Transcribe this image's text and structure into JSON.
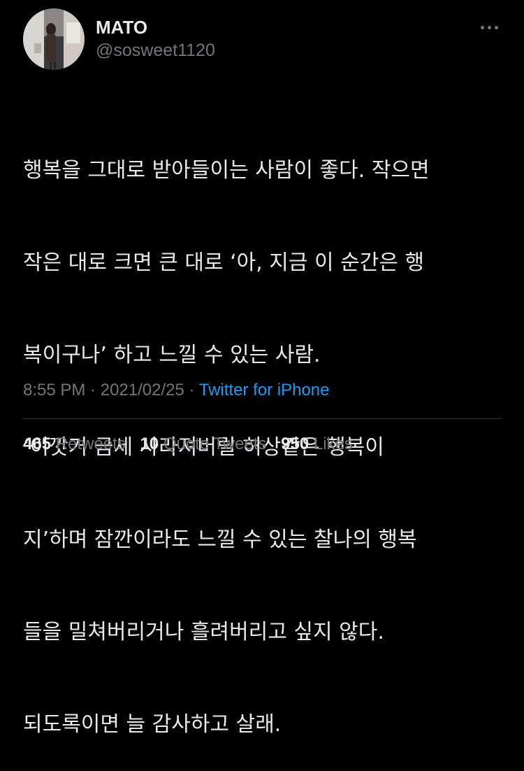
{
  "user": {
    "display_name": "MATO",
    "handle": "@sosweet1120",
    "avatar_icon": "profile-photo"
  },
  "more_icon": "ellipsis-icon",
  "tweet": {
    "lines": [
      "행복을 그대로 받아들이는 사람이 좋다. 작으면",
      "작은 대로 크면 큰 대로 ‘아, 지금 이 순간은 행",
      "복이구나’ 하고 느낄 수 있는 사람.",
      "‘이깟거 금세 사라져버릴 허상같은 행복이",
      "지’하며 잠깐이라도 느낄 수 있는 찰나의 행복",
      "들을 밀쳐버리거나 흘려버리고 싶지 않다.",
      "되도록이면 늘 감사하고 살래."
    ]
  },
  "meta": {
    "time": "8:55 PM",
    "separator": " · ",
    "date": "2021/02/25",
    "separator2": " · ",
    "source": "Twitter for iPhone"
  },
  "stats": {
    "retweets_count": "465",
    "retweets_label": "Retweets",
    "quotes_count": "10",
    "quotes_label": "Quote Tweets",
    "likes_count": "950",
    "likes_label": "Likes"
  },
  "colors": {
    "background": "#000000",
    "text": "#e7e9ea",
    "secondary": "#71767b",
    "link": "#1d9bf0",
    "divider": "#2f3336"
  }
}
